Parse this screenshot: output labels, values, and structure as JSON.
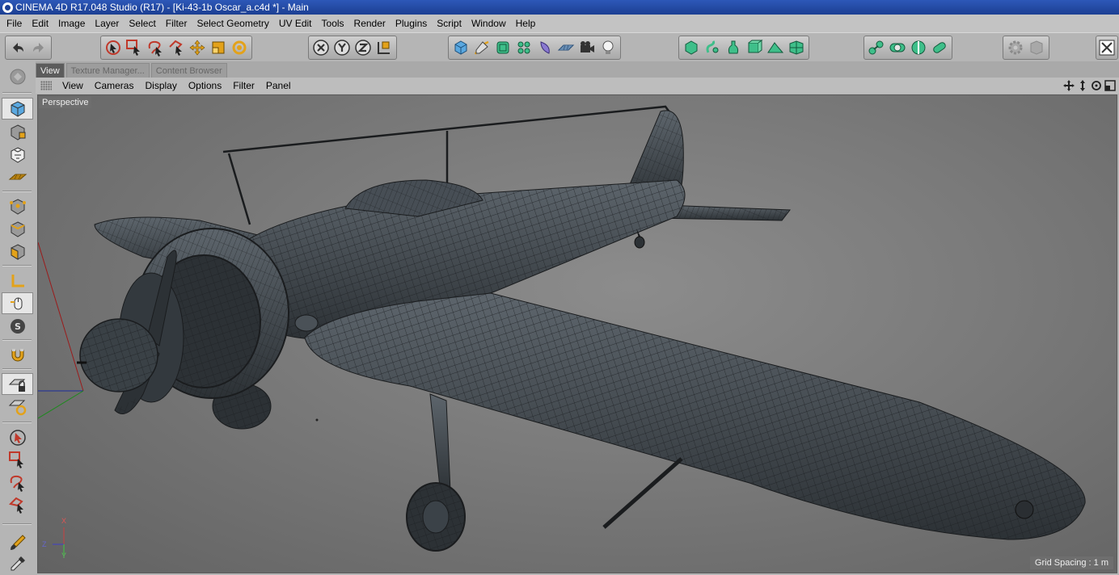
{
  "window": {
    "title": "CINEMA 4D R17.048 Studio (R17) - [Ki-43-1b Oscar_a.c4d *] - Main"
  },
  "menu": [
    "File",
    "Edit",
    "Image",
    "Layer",
    "Select",
    "Filter",
    "Select Geometry",
    "UV Edit",
    "Tools",
    "Render",
    "Plugins",
    "Script",
    "Window",
    "Help"
  ],
  "tabs": [
    {
      "label": "View",
      "active": true
    },
    {
      "label": "Texture Manager...",
      "active": false
    },
    {
      "label": "Content Browser",
      "active": false
    }
  ],
  "viewport_menu": [
    "View",
    "Cameras",
    "Display",
    "Options",
    "Filter",
    "Panel"
  ],
  "viewport": {
    "camera_label": "Perspective",
    "grid_spacing": "Grid Spacing : 1 m",
    "axis_labels": {
      "x": "X",
      "y": "Y",
      "z": "Z"
    }
  },
  "toolbar": {
    "icons": [
      "undo-icon",
      "redo-icon",
      "live-selection-icon",
      "rectangle-selection-icon",
      "lasso-selection-icon",
      "polygon-selection-icon",
      "move-icon",
      "scale-icon",
      "rotate-icon",
      "x-axis-icon",
      "y-axis-icon",
      "z-axis-icon",
      "world-coordinates-icon",
      "cube-icon",
      "pen-icon",
      "subdivision-icon",
      "cloner-icon",
      "deformer-icon",
      "floor-icon",
      "camera-icon",
      "light-icon",
      "render-view-icon",
      "render-region-icon",
      "render-picture-viewer-icon",
      "edit-render-settings-icon",
      "material-icon",
      "scene-icon",
      "layout-icon"
    ]
  },
  "colors": {
    "accent": "#2d58b8",
    "viewport_bg": "#7a7a7a",
    "mesh": "#3a3f44",
    "wire": "#1a1c1e"
  }
}
